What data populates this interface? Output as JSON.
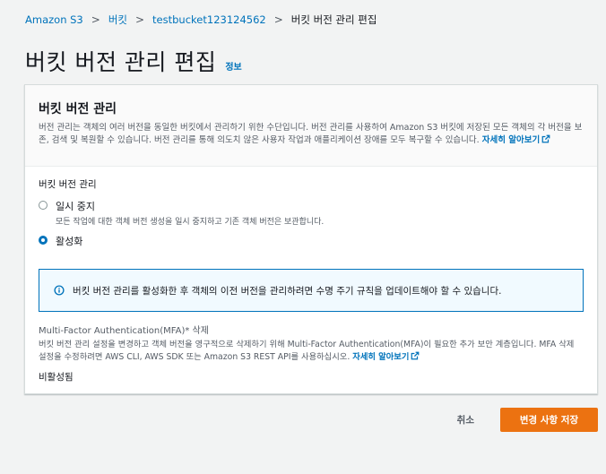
{
  "breadcrumb": {
    "items": [
      "Amazon S3",
      "버킷",
      "testbucket123124562"
    ],
    "current": "버킷 버전 관리 편집",
    "separator": ">"
  },
  "page": {
    "title": "버킷 버전 관리 편집",
    "info_link": "정보"
  },
  "panel": {
    "title": "버킷 버전 관리",
    "description": "버전 관리는 객체의 여러 버전을 동일한 버킷에서 관리하기 위한 수단입니다. 버전 관리를 사용하여 Amazon S3 버킷에 저장된 모든 객체의 각 버전을 보존, 검색 및 복원할 수 있습니다. 버전 관리를 통해 의도치 않은 사용자 작업과 애플리케이션 장애를 모두 복구할 수 있습니다.",
    "learn_more": "자세히 알아보기"
  },
  "versioning": {
    "label": "버킷 버전 관리",
    "options": [
      {
        "label": "일시 중지",
        "description": "모든 작업에 대한 객체 버전 생성을 일시 중지하고 기존 객체 버전은 보관합니다.",
        "selected": false
      },
      {
        "label": "활성화",
        "description": "",
        "selected": true
      }
    ]
  },
  "alert": {
    "message": "버킷 버전 관리를 활성화한 후 객체의 이전 버전을 관리하려면 수명 주기 규칙을 업데이트해야 할 수 있습니다."
  },
  "mfa": {
    "label": "Multi-Factor Authentication(MFA)* 삭제",
    "description": "버킷 버전 관리 설정을 변경하고 객체 버전을 영구적으로 삭제하기 위해 Multi-Factor Authentication(MFA)이 필요한 추가 보안 계층입니다. MFA 삭제 설정을 수정하려면 AWS CLI, AWS SDK 또는 Amazon S3 REST API를 사용하십시오.",
    "learn_more": "자세히 알아보기",
    "value": "비활성됨"
  },
  "footer": {
    "cancel": "취소",
    "save": "변경 사항 저장"
  },
  "colors": {
    "link": "#0073bb",
    "primary_button": "#ec7211",
    "background": "#f2f3f3",
    "alert_border": "#0073bb"
  }
}
